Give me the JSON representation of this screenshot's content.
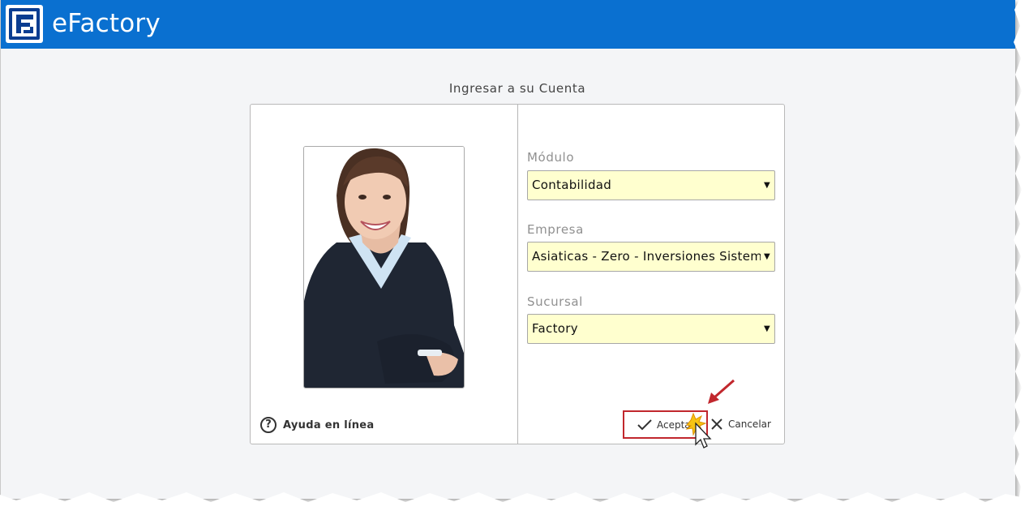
{
  "app": {
    "title": "eFactory",
    "brand_color": "#0a70d0"
  },
  "login": {
    "heading": "Ingresar a su Cuenta",
    "help_label": "Ayuda en línea",
    "help_icon_glyph": "?",
    "fields": [
      {
        "label": "Módulo",
        "value": "Contabilidad"
      },
      {
        "label": "Empresa",
        "value": "Asiaticas - Zero - Inversiones Sistemas"
      },
      {
        "label": "Sucursal",
        "value": "Factory"
      }
    ],
    "dropdown_arrow": "▼",
    "field_background": "#ffffcf",
    "accept_label": "Aceptar",
    "cancel_label": "Cancelar",
    "highlight_color": "#c1272d"
  },
  "icons": {
    "logo": "efactory-logo-icon",
    "help": "help-circle-icon",
    "accept": "checkmark-icon",
    "cancel": "close-icon",
    "annotation": "red-arrow-icon",
    "pointer": "mouse-cursor-icon"
  }
}
